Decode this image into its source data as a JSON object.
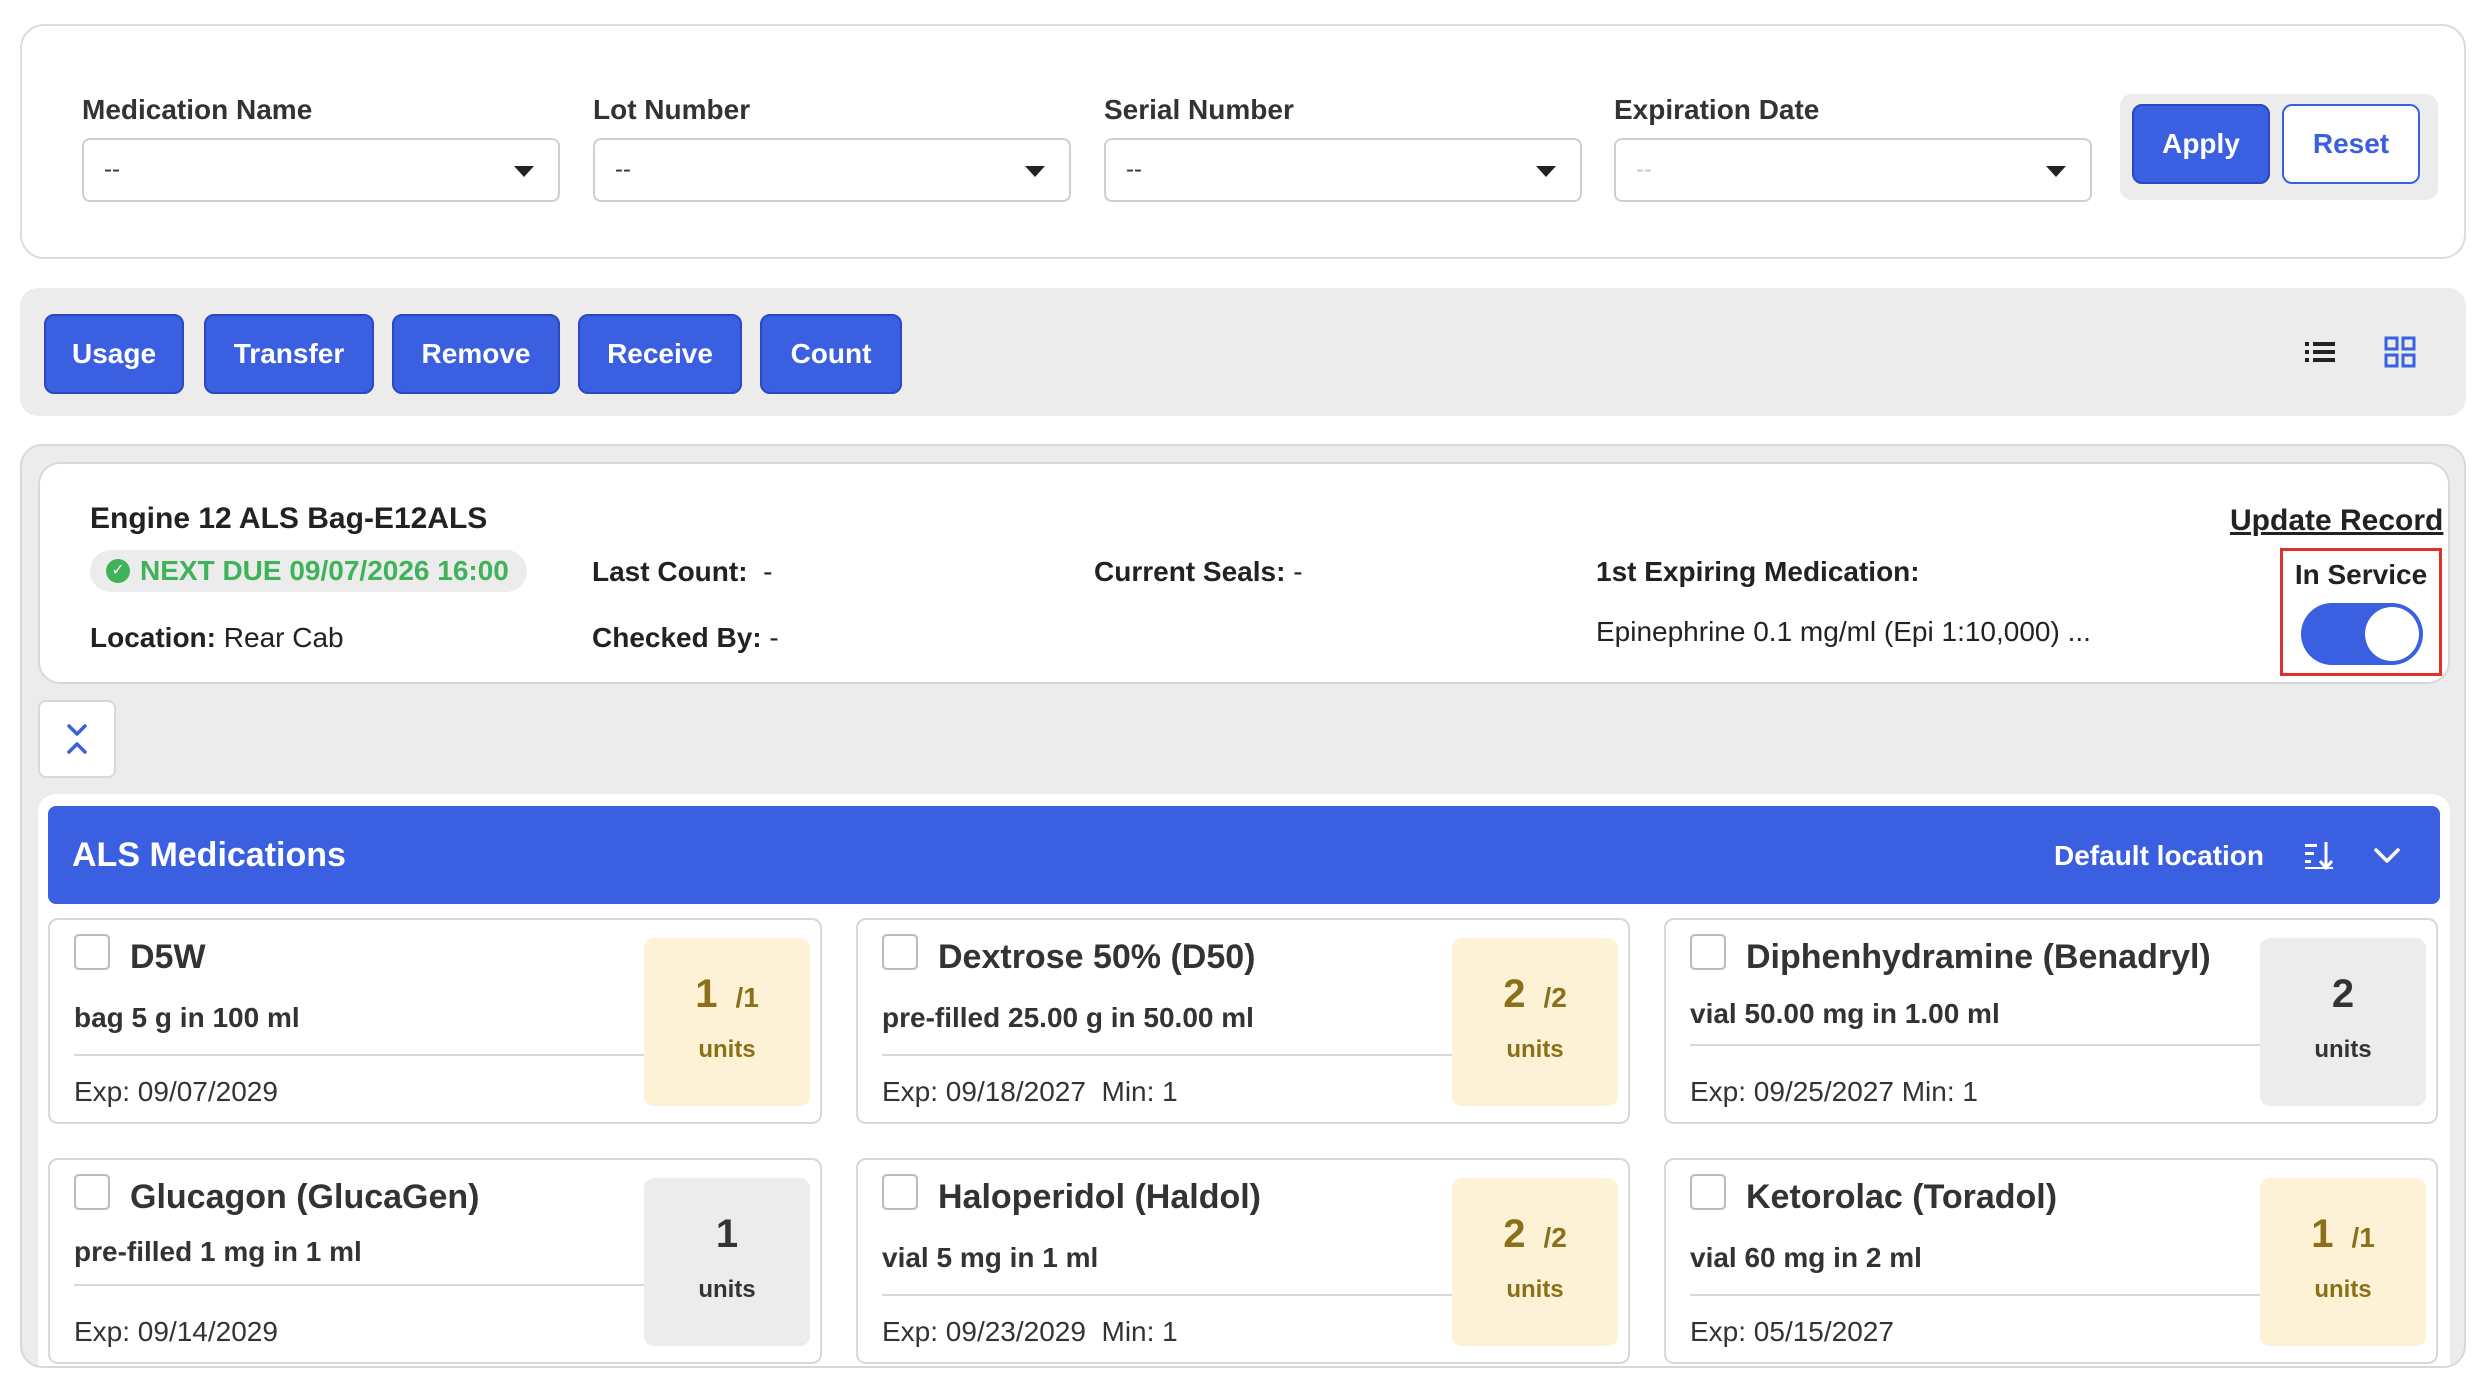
{
  "filters": [
    {
      "label": "Medication Name",
      "value": "--"
    },
    {
      "label": "Lot Number",
      "value": "--"
    },
    {
      "label": "Serial Number",
      "value": "--"
    },
    {
      "label": "Expiration Date",
      "value": "--"
    }
  ],
  "filter_actions": {
    "apply": "Apply",
    "reset": "Reset"
  },
  "actions": [
    "Usage",
    "Transfer",
    "Remove",
    "Receive",
    "Count"
  ],
  "record": {
    "name": "Engine 12 ALS Bag-E12ALS",
    "next_due": "NEXT DUE 09/07/2026 16:00",
    "location_label": "Location:",
    "location_value": "Rear Cab",
    "last_count_label": "Last Count:",
    "last_count_value": "-",
    "checked_by_label": "Checked By:",
    "checked_by_value": "-",
    "current_seals_label": "Current Seals:",
    "current_seals_value": "-",
    "first_expiring_label": "1st Expiring Medication:",
    "first_expiring_value": "Epinephrine 0.1 mg/ml (Epi 1:10,000) ...",
    "update_link": "Update Record",
    "service_label": "In Service",
    "in_service": true
  },
  "section": {
    "title": "ALS Medications",
    "location": "Default location"
  },
  "medications": [
    {
      "name": "D5W",
      "desc": "bag 5 g in 100 ml",
      "exp": "Exp: 09/07/2029",
      "qty": "1",
      "of": "/1",
      "unit": "units",
      "status": "warn"
    },
    {
      "name": "Dextrose 50% (D50)",
      "desc": "pre-filled 25.00 g in 50.00 ml",
      "exp": "Exp: 09/18/2027  Min: 1",
      "qty": "2",
      "of": "/2",
      "unit": "units",
      "status": "warn"
    },
    {
      "name": "Diphenhydramine (Benadryl)",
      "desc": "vial 50.00 mg in 1.00 ml",
      "exp": "Exp: 09/25/2027 Min: 1",
      "qty": "2",
      "of": "",
      "unit": "units",
      "status": "ok"
    },
    {
      "name": "Glucagon (GlucaGen)",
      "desc": "pre-filled 1 mg in 1 ml",
      "exp": "Exp: 09/14/2029",
      "qty": "1",
      "of": "",
      "unit": "units",
      "status": "ok"
    },
    {
      "name": "Haloperidol (Haldol)",
      "desc": "vial 5 mg in 1 ml",
      "exp": "Exp: 09/23/2029  Min: 1",
      "qty": "2",
      "of": "/2",
      "unit": "units",
      "status": "warn"
    },
    {
      "name": "Ketorolac (Toradol)",
      "desc": "vial 60 mg in 2 ml",
      "exp": "Exp: 05/15/2027",
      "qty": "1",
      "of": "/1",
      "unit": "units",
      "status": "warn"
    }
  ],
  "colors": {
    "primary": "#3a5fe0",
    "success": "#3fb25a",
    "warn_bg": "#fdf1d6",
    "warn_text": "#8a7018",
    "highlight": "#e0302a"
  },
  "icons": [
    "chevron-down-icon",
    "list-view-icon",
    "grid-view-icon",
    "check-circle-icon",
    "collapse-icon",
    "sort-icon"
  ]
}
